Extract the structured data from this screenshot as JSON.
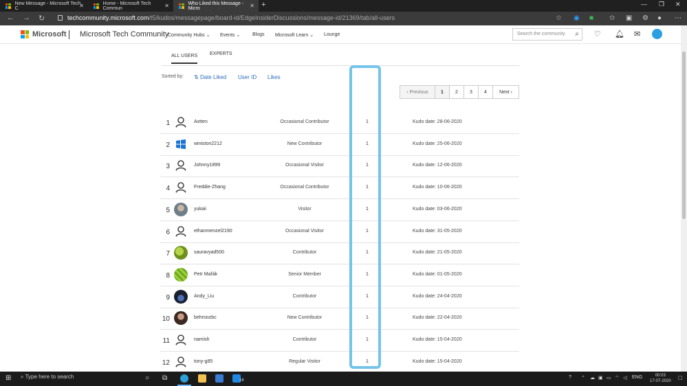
{
  "browser": {
    "tabs": [
      {
        "title": "New Message - Microsoft Tech C",
        "active": false
      },
      {
        "title": "Home - Microsoft Tech Commun",
        "active": false
      },
      {
        "title": "Who Liked this Message - Micro",
        "active": true
      }
    ],
    "url_host": "techcommunity.microsoft.com",
    "url_path": "/t5/kudos/messagepage/board-id/EdgeInsiderDiscussions/message-id/21369/tab/all-users"
  },
  "header": {
    "brand": "Microsoft",
    "site_title": "Microsoft Tech Community",
    "nav": [
      "Community Hubs",
      "Events",
      "Blogs",
      "Microsoft Learn",
      "Lounge"
    ],
    "search_placeholder": "Search the community"
  },
  "tabs": {
    "all_users": "ALL USERS",
    "experts": "EXPERTS"
  },
  "sort": {
    "label": "Sorted by:",
    "options": [
      "Date Liked",
      "User ID",
      "Likes"
    ]
  },
  "pagination": {
    "prev": "‹ Previous",
    "pages": [
      "1",
      "2",
      "3",
      "4"
    ],
    "current": "1",
    "next": "Next ›"
  },
  "users": [
    {
      "rank": "1",
      "name": "Axtten",
      "role": "Occasional Contributor",
      "likes": "1",
      "date": "Kudo date: 28-06-2020",
      "avatar": "placeholder"
    },
    {
      "rank": "2",
      "name": "winiston2212",
      "role": "New Contributor",
      "likes": "1",
      "date": "Kudo date: 25-06-2020",
      "avatar": "windows"
    },
    {
      "rank": "3",
      "name": "Johnny1899",
      "role": "Occasional Visitor",
      "likes": "1",
      "date": "Kudo date: 12-06-2020",
      "avatar": "placeholder"
    },
    {
      "rank": "4",
      "name": "Freddie-Zhang",
      "role": "Occasional Contributor",
      "likes": "1",
      "date": "Kudo date: 10-06-2020",
      "avatar": "placeholder"
    },
    {
      "rank": "5",
      "name": "yukaii",
      "role": "Visitor",
      "likes": "1",
      "date": "Kudo date: 03-06-2020",
      "avatar": "photo"
    },
    {
      "rank": "6",
      "name": "ethanmenzel2190",
      "role": "Occasional Visitor",
      "likes": "1",
      "date": "Kudo date: 31-05-2020",
      "avatar": "placeholder"
    },
    {
      "rank": "7",
      "name": "sauravyad500",
      "role": "Contributor",
      "likes": "1",
      "date": "Kudo date: 21-05-2020",
      "avatar": "green"
    },
    {
      "rank": "8",
      "name": "Petr Mařák",
      "role": "Senior Member",
      "likes": "1",
      "date": "Kudo date: 01-05-2020",
      "avatar": "leaf"
    },
    {
      "rank": "9",
      "name": "Andy_Liu",
      "role": "Contributor",
      "likes": "1",
      "date": "Kudo date: 24-04-2020",
      "avatar": "dark"
    },
    {
      "rank": "10",
      "name": "behroozbc",
      "role": "New Contributor",
      "likes": "1",
      "date": "Kudo date: 22-04-2020",
      "avatar": "portrait"
    },
    {
      "rank": "11",
      "name": "namish",
      "role": "Contributor",
      "likes": "1",
      "date": "Kudo date: 15-04-2020",
      "avatar": "placeholder"
    },
    {
      "rank": "12",
      "name": "tony-g85",
      "role": "Regular Visitor",
      "likes": "1",
      "date": "Kudo date: 15-04-2020",
      "avatar": "placeholder"
    }
  ],
  "taskbar": {
    "search_placeholder": "Type here to search",
    "lang": "ENG",
    "time": "00:03",
    "date": "17-07-2020",
    "notification_count": "16"
  },
  "colors": {
    "link": "#2a6ebb",
    "highlight": "#74c3ea",
    "ms_red": "#f25022",
    "ms_green": "#7fba00",
    "ms_blue": "#00a4ef",
    "ms_yellow": "#ffb900"
  }
}
